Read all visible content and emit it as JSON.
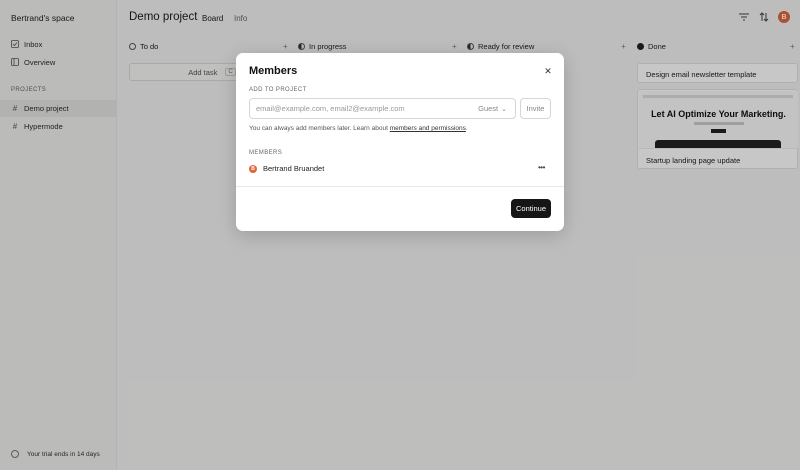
{
  "sidebar": {
    "workspace": "Bertrand's space",
    "nav": [
      {
        "label": "Inbox",
        "icon": "inbox-icon"
      },
      {
        "label": "Overview",
        "icon": "overview-icon"
      }
    ],
    "projects_label": "PROJECTS",
    "projects": [
      {
        "label": "Demo project"
      },
      {
        "label": "Hypermode"
      }
    ],
    "trial": "Your trial ends in 14 days"
  },
  "header": {
    "title": "Demo project",
    "tabs": [
      "Board",
      "Info"
    ]
  },
  "board": {
    "columns": [
      {
        "label": "To do"
      },
      {
        "label": "In progress"
      },
      {
        "label": "Ready for review"
      },
      {
        "label": "Done"
      }
    ],
    "add_task": "Add task",
    "add_task_key": "C",
    "cards": [
      {
        "title": "Design email newsletter template"
      },
      {
        "title": "Startup landing page update",
        "thumb_headline": "Let AI Optimize Your Marketing."
      }
    ]
  },
  "modal": {
    "title": "Members",
    "add_section": "ADD TO PROJECT",
    "input_placeholder": "email@example.com, email2@example.com",
    "role": "Guest",
    "invite": "Invite",
    "help_prefix": "You can always add members later. Learn about ",
    "help_link": "members and permissions",
    "help_suffix": ".",
    "members_section": "MEMBERS",
    "members": [
      {
        "name": "Bertrand Bruandet"
      }
    ],
    "continue": "Continue"
  },
  "colors": {
    "accent_avatar": "#e0663a",
    "primary_button": "#161616"
  }
}
